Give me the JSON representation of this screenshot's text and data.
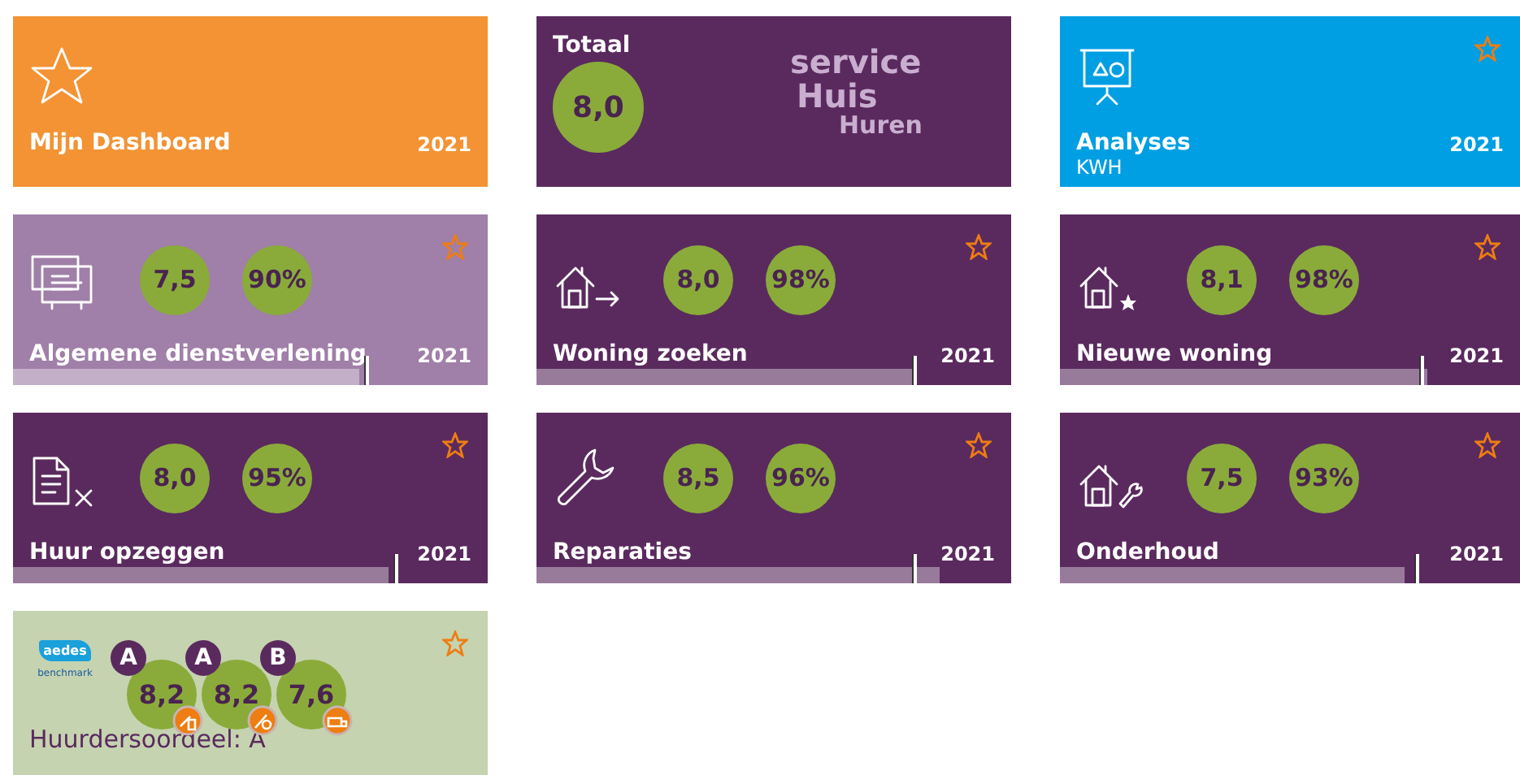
{
  "cards": [
    {
      "kind": "dashboard",
      "title": "Mijn Dashboard",
      "year": "2021",
      "starred": false
    },
    {
      "kind": "total",
      "label": "Totaal",
      "score": "8,0",
      "logo": [
        "service",
        "Huis",
        "Huren"
      ],
      "starred": false
    },
    {
      "kind": "analyses",
      "title": "Analyses",
      "subtitle": "KWH",
      "year": "2021",
      "starred": true
    },
    {
      "kind": "theme",
      "scores": [
        "7,5",
        "90%"
      ],
      "title": "Algemene dienstverlening",
      "year": "2021",
      "starred": true,
      "bar": {
        "level": 0.73
      },
      "target": {
        "level": 0.74
      }
    },
    {
      "kind": "theme",
      "scores": [
        "8,0",
        "98%"
      ],
      "title": "Woning zoeken",
      "year": "2021",
      "starred": true,
      "bar": {
        "level": 0.79
      },
      "target": {
        "level": 0.79
      }
    },
    {
      "kind": "theme",
      "scores": [
        "8,1",
        "98%"
      ],
      "title": "Nieuwe woning",
      "year": "2021",
      "starred": true,
      "bar": {
        "level": 0.8
      },
      "target": {
        "level": 0.78
      }
    },
    {
      "kind": "theme",
      "scores": [
        "8,0",
        "95%"
      ],
      "title": "Huur opzeggen",
      "year": "2021",
      "starred": true,
      "bar": {
        "level": 0.79
      },
      "target": {
        "level": 0.8
      }
    },
    {
      "kind": "theme",
      "scores": [
        "8,5",
        "96%"
      ],
      "title": "Reparaties",
      "year": "2021",
      "starred": true,
      "bar": {
        "level": 0.85
      },
      "target": {
        "level": 0.79
      }
    },
    {
      "kind": "theme",
      "scores": [
        "7,5",
        "93%"
      ],
      "title": "Onderhoud",
      "year": "2021",
      "starred": true,
      "bar": {
        "level": 0.75
      },
      "target": {
        "level": 0.77
      }
    },
    {
      "kind": "benchmark",
      "logo": [
        "aedes",
        "benchmark"
      ],
      "ratings": [
        {
          "grade": "A",
          "score": "8,2"
        },
        {
          "grade": "A",
          "score": "8,2"
        },
        {
          "grade": "B",
          "score": "7,6"
        }
      ],
      "title": "Huurdersoordeel: A",
      "starred": true
    }
  ]
}
